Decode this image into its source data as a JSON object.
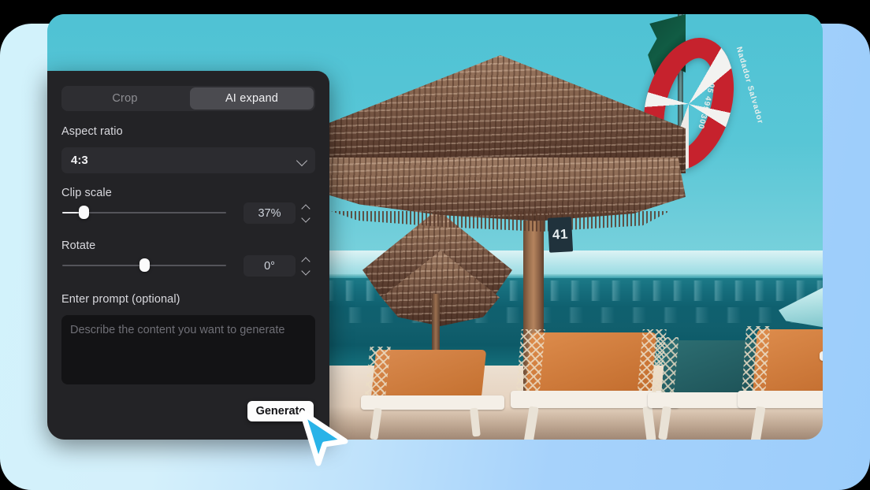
{
  "app": {
    "panel_title": "AI expand tool panel"
  },
  "tabs": [
    {
      "id": "crop",
      "label": "Crop",
      "active": false
    },
    {
      "id": "ai-expand",
      "label": "AI expand",
      "active": true
    }
  ],
  "aspect_ratio": {
    "label": "Aspect ratio",
    "value": "4:3",
    "icon": "chevron-down-icon"
  },
  "clip_scale": {
    "label": "Clip scale",
    "value": "37%",
    "percent": 12
  },
  "rotate": {
    "label": "Rotate",
    "value": "0°",
    "percent": 50
  },
  "prompt": {
    "label": "Enter prompt (optional)",
    "placeholder": "Describe the content you want to generate",
    "value": ""
  },
  "actions": {
    "generate_label": "Generate"
  },
  "photo": {
    "alt": "Beach scene with thatched umbrellas, sun loungers and a life ring",
    "umbrella_tag": "41",
    "life_ring_text": "Nadador Salvador",
    "life_ring_phone": "305 499 300"
  },
  "colors": {
    "panel_bg": "#232326",
    "tab_active_bg": "#4b4b50",
    "accent_button_bg": "#fdfdfd",
    "cursor_fill": "#29b3e8",
    "backdrop_blue_light": "#d2f2fb",
    "backdrop_blue_dark": "#9ccdfb"
  }
}
